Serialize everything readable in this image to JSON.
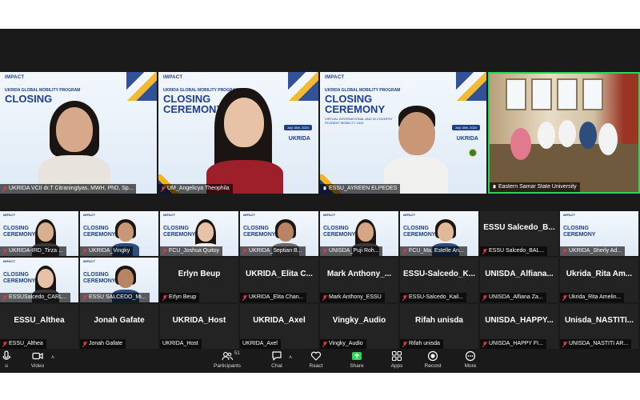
{
  "meeting": {
    "speakers": [
      {
        "name": "UKRIDA VCII dr.T Citraningtyas, MWH, PhD, Sp...",
        "muted": true
      },
      {
        "name": "UM_Angelicya Theophila",
        "muted": true
      },
      {
        "name": "ESSU_AYREEN ELPEDES",
        "muted": false
      },
      {
        "name": "Eastern Samar State University",
        "muted": false,
        "active": true
      }
    ],
    "slide": {
      "brand": "IMPACT",
      "program": "UKRIDA GLOBAL MOBILITY PROGRAM",
      "title_line1": "CLOSING",
      "title_line2": "CEREMONY",
      "subtitle": "VIRTUAL INTERNATIONAL AND IN COUNTRY STUDENT MOBILITY 2024",
      "date": "July 16th, 2024",
      "logo": "UKRIDA"
    },
    "gallery": [
      {
        "name": "UKRIDA-IRD_Tirza ...",
        "type": "video"
      },
      {
        "name": "UKRIDA_Vingky",
        "type": "video"
      },
      {
        "name": "FCU_Joshua Quitoy",
        "type": "video"
      },
      {
        "name": "UKRIDA_Septian B...",
        "type": "video"
      },
      {
        "name": "UNISDA_Puji Roh...",
        "type": "video"
      },
      {
        "name": "FCU_Ma. Estelle An...",
        "type": "video"
      },
      {
        "name": "ESSU Salcedo_BAL...",
        "type": "label",
        "label": "ESSU Salcedo_B..."
      },
      {
        "name": "UKRIDA_Sherly Ad...",
        "type": "slide"
      },
      {
        "name": "ESSUSalcedo_CARL...",
        "type": "video"
      },
      {
        "name": "ESSU SALCEDO_Mi...",
        "type": "video"
      },
      {
        "name": "Erlyn Beup",
        "type": "label",
        "label": "Erlyn Beup"
      },
      {
        "name": "UKRIDA_Elita Chan...",
        "type": "label",
        "label": "UKRIDA_Elita C..."
      },
      {
        "name": "Mark Anthony_ESSU",
        "type": "label",
        "label": "Mark Anthony_..."
      },
      {
        "name": "ESSU-Salcedo_Kail...",
        "type": "label",
        "label": "ESSU-Salcedo_K..."
      },
      {
        "name": "UNISDA_Alfiana Za...",
        "type": "label",
        "label": "UNISDA_Alfiana..."
      },
      {
        "name": "Ukrida_Rita Amelin...",
        "type": "label",
        "label": "Ukrida_Rita Am..."
      },
      {
        "name": "ESSU_Althea",
        "type": "label",
        "label": "ESSU_Althea"
      },
      {
        "name": "Jonah Gafate",
        "type": "label",
        "label": "Jonah Gafate"
      },
      {
        "name": "UKRIDA_Host",
        "type": "label",
        "label": "UKRIDA_Host",
        "unmuted": true
      },
      {
        "name": "UKRIDA_Axel",
        "type": "label",
        "label": "UKRIDA_Axel",
        "unmuted": true
      },
      {
        "name": "Vingky_Audio",
        "type": "label",
        "label": "Vingky_Audio"
      },
      {
        "name": "Rifah unisda",
        "type": "label",
        "label": "Rifah unisda"
      },
      {
        "name": "UNISDA_HAPPY FI...",
        "type": "label",
        "label": "UNISDA_HAPPY..."
      },
      {
        "name": "UNISDA_NASTITI AR...",
        "type": "label",
        "label": "Unisda_NASTITI..."
      }
    ]
  },
  "toolbar": {
    "audio_label": "o",
    "video_label": "Video",
    "participants_label": "Participants",
    "participants_count": "51",
    "chat_label": "Chat",
    "react_label": "React",
    "share_label": "Share",
    "apps_label": "Apps",
    "record_label": "Record",
    "more_label": "More"
  },
  "colors": {
    "active_speaker_border": "#2fd35a",
    "muted_icon": "#e0393e",
    "share_green": "#2fd35a",
    "slide_blue": "#1d3f8c",
    "slide_gold": "#f2b41c"
  }
}
